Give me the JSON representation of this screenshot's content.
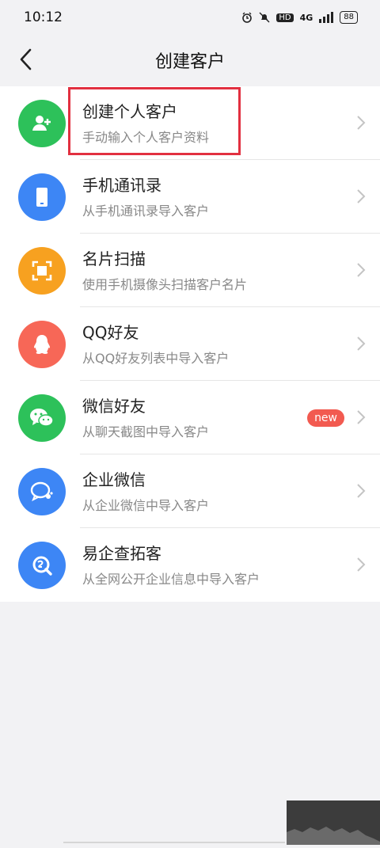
{
  "status_bar": {
    "time": "10:12",
    "hd": "HD",
    "network": "4G",
    "battery": "88"
  },
  "header": {
    "title": "创建客户",
    "back_icon": "chevron-left-icon"
  },
  "items": [
    {
      "title": "创建个人客户",
      "subtitle": "手动输入个人客户资料",
      "icon": "add-person-icon",
      "color": "#2dc15a"
    },
    {
      "title": "手机通讯录",
      "subtitle": "从手机通讯录导入客户",
      "icon": "phone-icon",
      "color": "#3d86f5"
    },
    {
      "title": "名片扫描",
      "subtitle": "使用手机摄像头扫描客户名片",
      "icon": "scan-icon",
      "color": "#f7a120"
    },
    {
      "title": "QQ好友",
      "subtitle": "从QQ好友列表中导入客户",
      "icon": "qq-penguin-icon",
      "color": "#f76757"
    },
    {
      "title": "微信好友",
      "subtitle": "从聊天截图中导入客户",
      "icon": "wechat-icon",
      "color": "#2dc15a",
      "badge": "new"
    },
    {
      "title": "企业微信",
      "subtitle": "从企业微信中导入客户",
      "icon": "work-wechat-icon",
      "color": "#3d86f5"
    },
    {
      "title": "易企查拓客",
      "subtitle": "从全网公开企业信息中导入客户",
      "icon": "search-company-icon",
      "color": "#3d86f5"
    }
  ]
}
